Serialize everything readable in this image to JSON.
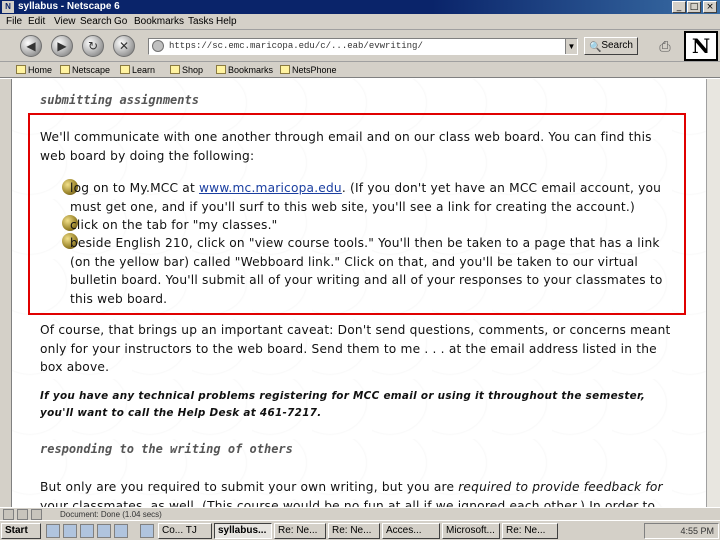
{
  "window": {
    "title": "syllabus - Netscape 6",
    "controls": [
      "_",
      "□",
      "×"
    ]
  },
  "menu": [
    "File",
    "Edit",
    "View",
    "Search",
    "Go",
    "Bookmarks",
    "Tasks",
    "Help"
  ],
  "nav": {
    "url": "https://sc.emc.maricopa.edu/c/...eab/evwriting/",
    "search_label": "Search",
    "buttons": [
      "back-icon",
      "forward-icon",
      "reload-icon",
      "stop-icon"
    ]
  },
  "personal_toolbar": [
    "Home",
    "Netscape",
    "Learn",
    "Shop",
    "Bookmarks",
    "NetsPhone"
  ],
  "content": {
    "section1_title": "submitting assignments",
    "intro": "We'll communicate with one another through email and on our class web board. You can find this web board by doing the following:",
    "bullet1_pre": "log on to My.MCC at ",
    "bullet1_link": "www.mc.maricopa.edu",
    "bullet1_post": ". (If you don't yet have an MCC email account, you must get one, and if you'll surf to this web site, you'll see a link for creating the account.)",
    "bullet2": "click on the tab for \"my classes.\"",
    "bullet3": "beside English 210, click on \"view course tools.\" You'll then be taken to a page that has a link (on the yellow bar) called \"Webboard link.\" Click on that, and you'll be taken to our virtual bulletin board. You'll submit all of your writing and all of your responses to your classmates to this web board.",
    "caveat": "Of course, that brings up an important caveat: Don't send questions, comments, or concerns meant only for your instructors to the web board. Send them to me . . . at the email address listed in the box above.",
    "helpdesk": "If you have any technical problems registering for MCC email or using it throughout the semester, you'll want to call the Help Desk at 461-7217.",
    "section2_title": "responding to the writing of others",
    "respond_pre": "But only are you required to submit your own writing, but you are ",
    "respond_em": "required to provide feedback for",
    "respond_post": " your classmates, as well. (This course would be no fun at all if we ignored each other.) In order to"
  },
  "status": {
    "text": "Document: Done (1.04 secs)"
  },
  "taskbar": {
    "start_label": "Start",
    "tasks": [
      "Co... TJ",
      "syllabus...",
      "Re: Ne...",
      "Re: Ne...",
      "Acces...",
      "Microsoft...",
      "Re: Ne..."
    ],
    "clock": "4:55 PM"
  },
  "colors": {
    "titlebar": "#0a246a",
    "chrome": "#d4d0c8",
    "highlight_box": "#e00000",
    "link": "#1a3ea0"
  }
}
